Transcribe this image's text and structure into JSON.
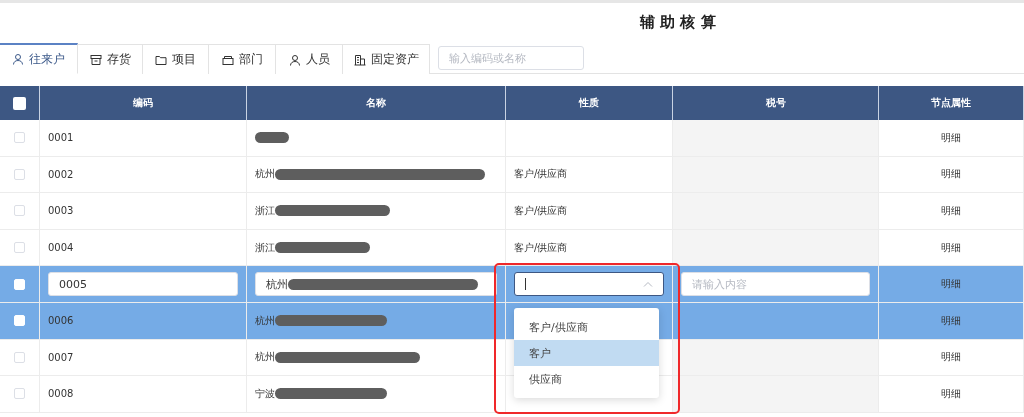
{
  "title": "辅 助 核 算",
  "tabs": [
    {
      "label": "往来户",
      "selected": true
    },
    {
      "label": "存货",
      "selected": false
    },
    {
      "label": "项目",
      "selected": false
    },
    {
      "label": "部门",
      "selected": false
    },
    {
      "label": "人员",
      "selected": false
    },
    {
      "label": "固定资产",
      "selected": false
    }
  ],
  "search": {
    "placeholder": "输入编码或名称"
  },
  "table": {
    "columns": [
      "编码",
      "名称",
      "性质",
      "税号",
      "节点属性"
    ],
    "header_checked": false,
    "rows": [
      {
        "code": "0001",
        "name": "",
        "nature": "",
        "node": "明细",
        "selected": false,
        "editing": false
      },
      {
        "code": "0002",
        "name": "杭州",
        "nature": "客户/供应商",
        "node": "明细",
        "selected": false,
        "editing": false
      },
      {
        "code": "0003",
        "name": "浙江",
        "nature": "客户/供应商",
        "node": "明细",
        "selected": false,
        "editing": false
      },
      {
        "code": "0004",
        "name": "浙江",
        "nature": "客户/供应商",
        "node": "明细",
        "selected": false,
        "editing": false
      },
      {
        "code": "0005",
        "name": "杭州",
        "nature": "",
        "tax_placeholder": "请输入内容",
        "node": "明细",
        "selected": true,
        "editing": true
      },
      {
        "code": "0006",
        "name": "杭州",
        "nature": "",
        "node": "明细",
        "selected": true,
        "editing": false
      },
      {
        "code": "0007",
        "name": "杭州",
        "nature": "",
        "node": "明细",
        "selected": false,
        "editing": false
      },
      {
        "code": "0008",
        "name": "宁波",
        "nature": "",
        "node": "明细",
        "selected": false,
        "editing": false
      }
    ]
  },
  "dropdown": {
    "open": true,
    "options": [
      {
        "label": "客户/供应商",
        "selected": false
      },
      {
        "label": "客户",
        "selected": true
      },
      {
        "label": "供应商",
        "selected": false
      }
    ]
  },
  "highlight_frame": true
}
